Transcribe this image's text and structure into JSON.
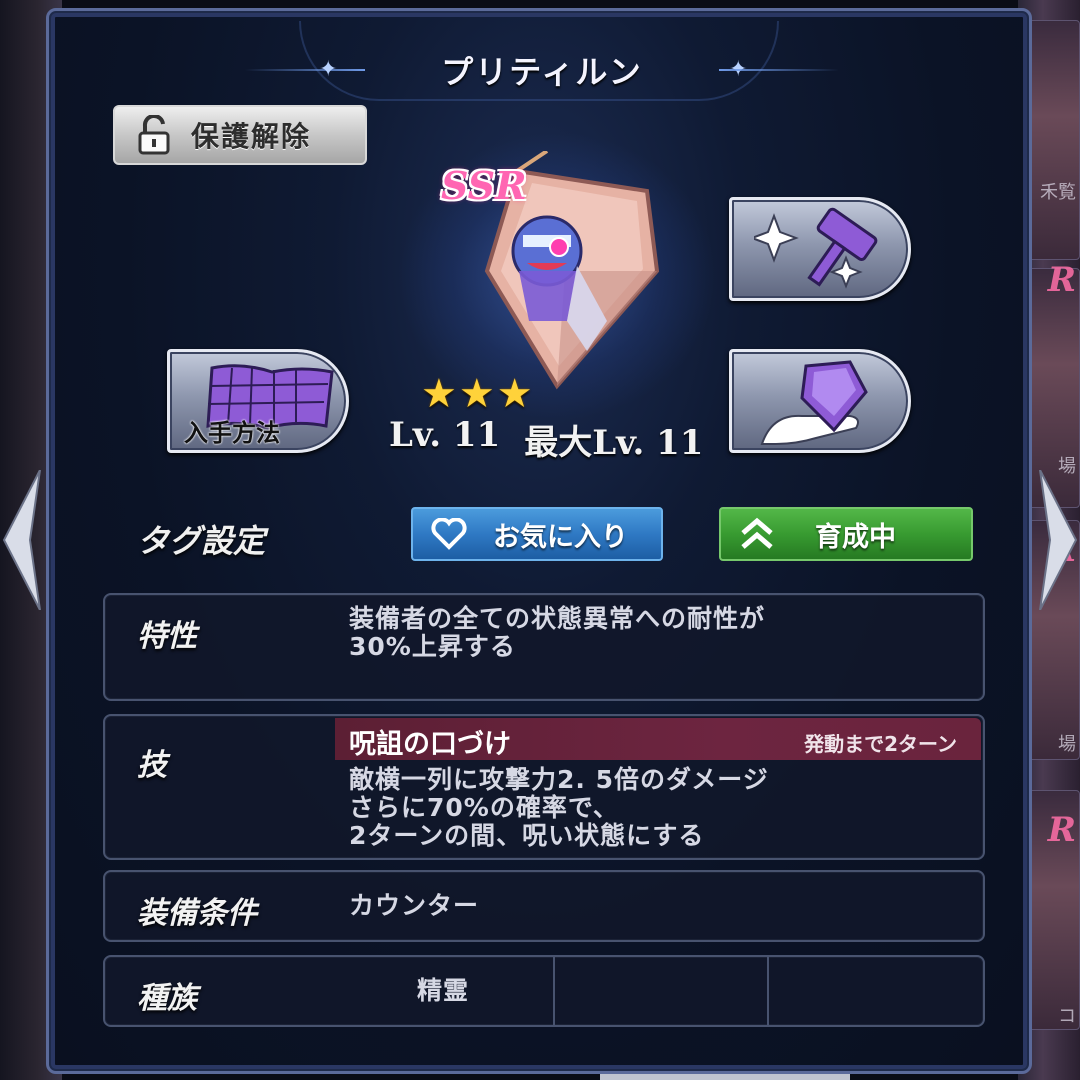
{
  "title": "プリティルン",
  "protect_button": {
    "label": "保護解除",
    "icon": "unlock-icon"
  },
  "item": {
    "rarity": "SSR",
    "stars": 3,
    "level_text": "Lv. 11",
    "max_level_text": "最大Lv. 11"
  },
  "actions": {
    "acquire_label": "入手方法",
    "forge_icon": "forge-hammer-icon",
    "gem_icon": "gem-hand-icon"
  },
  "tags": {
    "label": "タグ設定",
    "favorite_label": "お気に入り",
    "training_label": "育成中"
  },
  "trait": {
    "label": "特性",
    "line1": "装備者の全ての状態異常への耐性が",
    "line2": "30%上昇する"
  },
  "skill": {
    "label": "技",
    "name": "呪詛の口づけ",
    "turns": "発動まで2ターン",
    "line1": "敵横一列に攻撃力2. 5倍のダメージ",
    "line2": "さらに70%の確率で、",
    "line3": "2ターンの間、呪い状態にする"
  },
  "equip_condition": {
    "label": "装備条件",
    "value": "カウンター"
  },
  "race": {
    "label": "種族",
    "value": "精霊"
  },
  "side_peek": {
    "right_letters": [
      "R",
      "R",
      "R"
    ],
    "right_texts": [
      "禾覧",
      "場",
      "場",
      "コ"
    ]
  },
  "colors": {
    "favorite": "#2f79c4",
    "training": "#389b31",
    "skill_header": "#6d2540",
    "ssr": "#ff66b2",
    "star": "#ffd23a"
  }
}
